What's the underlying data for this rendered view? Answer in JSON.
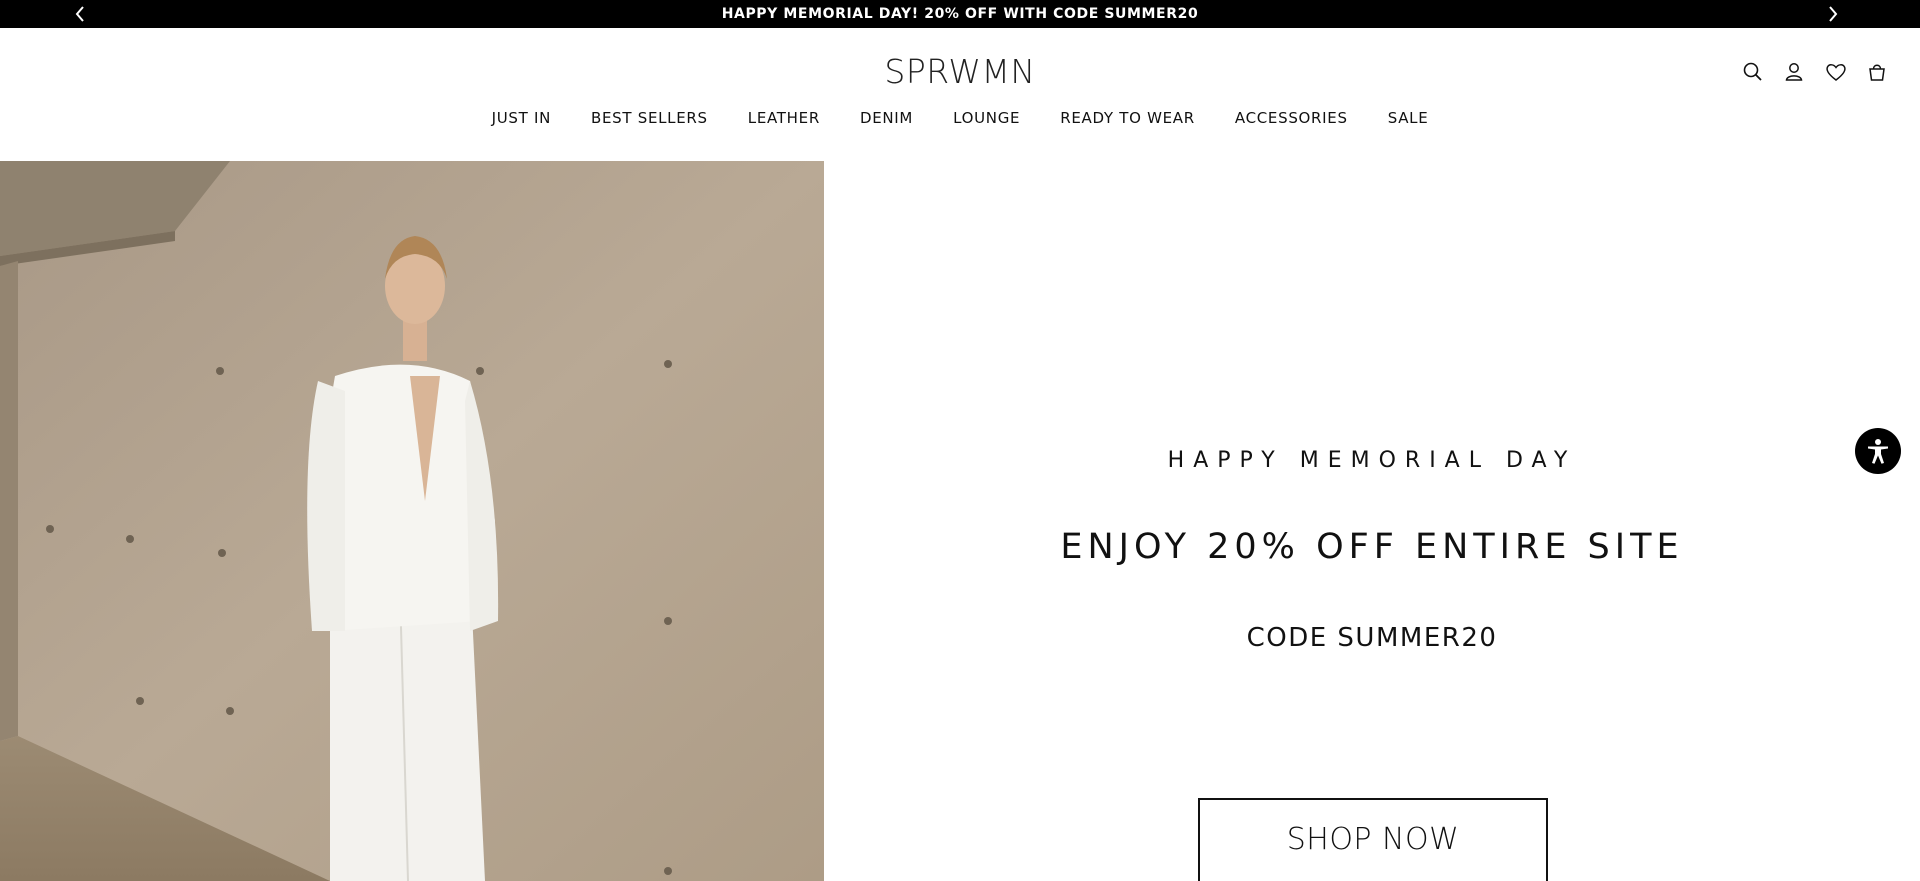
{
  "announcement": {
    "text": "HAPPY MEMORIAL DAY! 20% OFF WITH CODE SUMMER20",
    "prev_icon": "chevron-left-icon",
    "next_icon": "chevron-right-icon"
  },
  "header": {
    "logo": "SPRWMN",
    "icons": [
      "search-icon",
      "account-icon",
      "wishlist-heart-icon",
      "shopping-bag-icon"
    ]
  },
  "nav": {
    "items": [
      {
        "label": "JUST IN"
      },
      {
        "label": "BEST SELLERS"
      },
      {
        "label": "LEATHER"
      },
      {
        "label": "DENIM"
      },
      {
        "label": "LOUNGE"
      },
      {
        "label": "READY TO WEAR"
      },
      {
        "label": "ACCESSORIES"
      },
      {
        "label": "SALE"
      }
    ]
  },
  "promo": {
    "kicker": "HAPPY MEMORIAL DAY",
    "headline": "ENJOY 20% OFF ENTIRE SITE",
    "code_label": "CODE",
    "code_value": "SUMMER20",
    "cta": "SHOP NOW"
  },
  "accessibility": {
    "icon": "accessibility-icon"
  },
  "colors": {
    "announcement_bg": "#000000",
    "text": "#111111",
    "background": "#ffffff",
    "photo_wall": "#b3a492"
  }
}
